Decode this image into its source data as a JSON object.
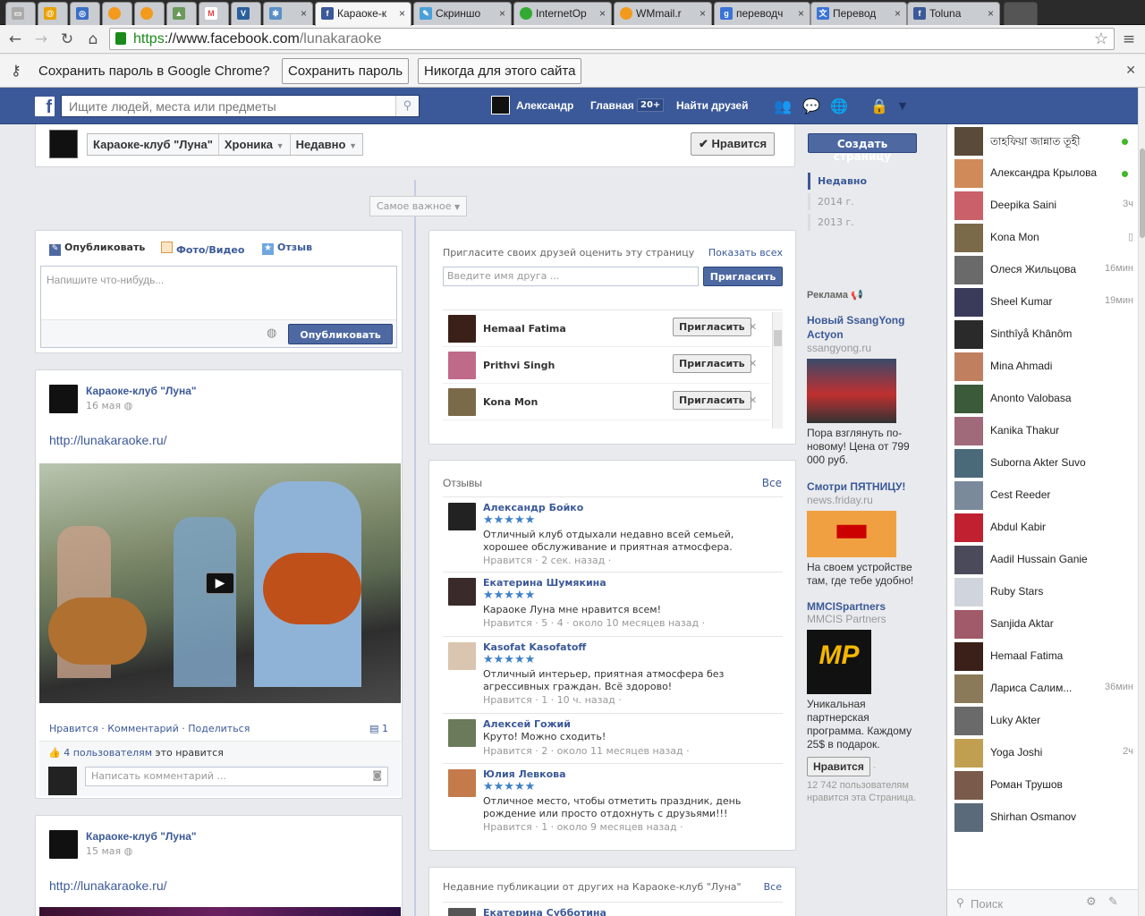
{
  "browser": {
    "tabs": [
      {
        "label": "",
        "icon": "doc-icon"
      },
      {
        "label": "",
        "icon": "mail-icon"
      },
      {
        "label": "",
        "icon": "globe-icon"
      },
      {
        "label": "",
        "icon": "orange-icon"
      },
      {
        "label": "",
        "icon": "orange2-icon"
      },
      {
        "label": "",
        "icon": "photo-icon"
      },
      {
        "label": "",
        "icon": "gmail-icon"
      },
      {
        "label": "",
        "icon": "v-icon"
      },
      {
        "label": "",
        "icon": "wolf-icon"
      },
      {
        "label": "Караоке-к",
        "icon": "facebook-icon",
        "active": true
      },
      {
        "label": "Скриншо",
        "icon": "screenshot-icon"
      },
      {
        "label": "InternetOp",
        "icon": "green-dot-icon"
      },
      {
        "label": "WMmail.r",
        "icon": "wm-icon"
      },
      {
        "label": "переводч",
        "icon": "google-icon"
      },
      {
        "label": "Перевод",
        "icon": "translate-icon"
      },
      {
        "label": "Toluna",
        "icon": "facebook-icon"
      }
    ],
    "url_scheme": "https",
    "url_host": "://www.facebook.com",
    "url_path": "/lunakaraoke",
    "password_prompt": "Сохранить пароль в Google Chrome?",
    "save_password": "Сохранить пароль",
    "never_for_site": "Никогда для этого сайта"
  },
  "fb_header": {
    "search_placeholder": "Ищите людей, места или предметы",
    "user_name": "Александр",
    "home": "Главная",
    "home_badge": "20+",
    "find_friends": "Найти друзей"
  },
  "page_header": {
    "page_name": "Караоке-клуб \"Луна\"",
    "timeline": "Хроника",
    "recent": "Недавно",
    "like_button": "✔ Нравится",
    "create_page": "Создать страницу"
  },
  "timeline_nav": {
    "items": [
      "Недавно",
      "2014 г.",
      "2013 г."
    ]
  },
  "filter": "Самое важное",
  "composer": {
    "tabs": [
      "Опубликовать",
      "Фото/Видео",
      "Отзыв"
    ],
    "placeholder": "Напишите что-нибудь...",
    "publish": "Опубликовать"
  },
  "post1": {
    "author": "Караоке-клуб \"Луна\"",
    "date": "16 мая",
    "link": "http://lunakaraoke.ru/",
    "actions": [
      "Нравится",
      "Комментарий",
      "Поделиться"
    ],
    "share_count": "1",
    "likes_link": "4 пользователям",
    "likes_rest": " это нравится",
    "comment_placeholder": "Написать комментарий ..."
  },
  "post2": {
    "author": "Караоке-клуб \"Луна\"",
    "date": "15 мая",
    "link": "http://lunakaraoke.ru/"
  },
  "invite": {
    "title": "Пригласите своих друзей оценить эту страницу",
    "show_all": "Показать всех",
    "placeholder": "Введите имя друга ...",
    "invite_btn": "Пригласить",
    "friends": [
      "Hemaal Fatima",
      "Prithvi Singh",
      "Kona Mon"
    ],
    "row_btn": "Пригласить"
  },
  "reviews": {
    "title": "Отзывы",
    "all": "Все",
    "items": [
      {
        "name": "Александр Бойко",
        "text": "Отличный клуб отдыхали недавно всей семьей, хорошее обслуживание и приятная атмосфера.",
        "meta": "Нравится · 2 сек. назад ·"
      },
      {
        "name": "Екатерина Шумякина",
        "text": "Караоке Луна мне нравится всем!",
        "meta": "Нравится · 5 · 4 · около 10 месяцев назад ·"
      },
      {
        "name": "Kasofat Kasofatoff",
        "text": "Отличный интерьер, приятная атмосфера без агрессивных граждан. Всё здорово!",
        "meta": "Нравится · 1 · 10 ч. назад ·"
      },
      {
        "name": "Алексей Гожий",
        "text": "Круто! Можно сходить!",
        "meta": "Нравится · 2 · около 11 месяцев назад ·"
      },
      {
        "name": "Юлия Левкова",
        "text": "Отличное место, чтобы отметить праздник, день рождение или просто отдохнуть с друзьями!!!",
        "meta": "Нравится · 1 · около 9 месяцев назад ·"
      }
    ]
  },
  "recent_posts": {
    "title": "Недавние публикации от других на Караоке-клуб \"Луна\"",
    "all": "Все",
    "first_name": "Екатерина Субботина"
  },
  "ads": {
    "title": "Реклама",
    "items": [
      {
        "title": "Новый SsangYong Actyon",
        "domain": "ssangyong.ru",
        "text": "Пора взглянуть по-новому! Цена от 799 000 руб."
      },
      {
        "title": "Смотри ПЯТНИЦУ!",
        "domain": "news.friday.ru",
        "text": "На своем устройстве там, где тебе удобно!"
      },
      {
        "title": "MMCISpartners",
        "domain": "MMCIS Partners",
        "text": "Уникальная партнерская программа. Каждому 25$ в подарок."
      }
    ],
    "like": "Нравится",
    "likes_count": "12 742 пользователям нравится эта Страница."
  },
  "chat": {
    "search_placeholder": "Поиск",
    "friends": [
      {
        "name": "তাহফিয়া জান্নাত তূহী",
        "status": "online"
      },
      {
        "name": "Александра Крылова",
        "status": "online"
      },
      {
        "name": "Deepika Saini",
        "status": "3ч"
      },
      {
        "name": "Kona Mon",
        "status": "mobile"
      },
      {
        "name": "Олеся Жильцова",
        "status": "16мин"
      },
      {
        "name": "Sheel Kumar",
        "status": "19мин"
      },
      {
        "name": "Sinthîyå Khânôm",
        "status": ""
      },
      {
        "name": "Mina Ahmadi",
        "status": ""
      },
      {
        "name": "Anonto Valobasa",
        "status": ""
      },
      {
        "name": "Kanika Thakur",
        "status": ""
      },
      {
        "name": "Suborna Akter Suvo",
        "status": ""
      },
      {
        "name": "Cest Reeder",
        "status": ""
      },
      {
        "name": "Abdul Kabir",
        "status": ""
      },
      {
        "name": "Aadil Hussain Ganie",
        "status": ""
      },
      {
        "name": "Ruby Stars",
        "status": ""
      },
      {
        "name": "Sanjida Aktar",
        "status": ""
      },
      {
        "name": "Hemaal Fatima",
        "status": ""
      },
      {
        "name": "Лариса Салим...",
        "status": "36мин"
      },
      {
        "name": "Luky Akter",
        "status": ""
      },
      {
        "name": "Yoga Joshi",
        "status": "2ч"
      },
      {
        "name": "Роман Трушов",
        "status": ""
      },
      {
        "name": "Shirhan Osmanov",
        "status": ""
      }
    ]
  },
  "colors": {
    "fb_blue": "#3b5998",
    "star_blue": "#3f81c6",
    "online_green": "#42b72a"
  }
}
